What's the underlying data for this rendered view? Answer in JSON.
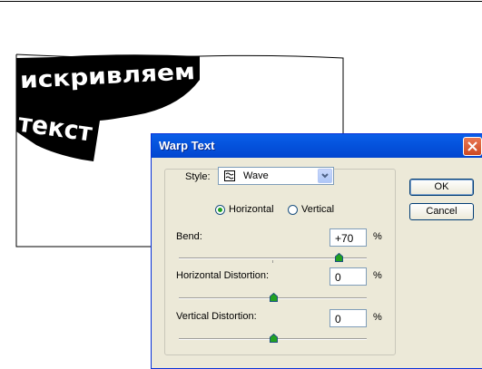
{
  "canvas": {
    "warped_line1": "искривляем",
    "warped_line2": "текст"
  },
  "dialog": {
    "title": "Warp Text",
    "style_label": "Style:",
    "style_value": "Wave",
    "style_icon": "wave-style-icon",
    "orientation_options": [
      "Horizontal",
      "Vertical"
    ],
    "orientation_selected": "Horizontal",
    "bend_label": "Bend:",
    "bend_value": "+70",
    "bend_unit": "%",
    "bend_slider_fraction": 0.85,
    "hdist_label": "Horizontal Distortion:",
    "hdist_value": "0",
    "hdist_unit": "%",
    "hdist_slider_fraction": 0.5,
    "vdist_label": "Vertical Distortion:",
    "vdist_value": "0",
    "vdist_unit": "%",
    "vdist_slider_fraction": 0.5,
    "ok_label": "OK",
    "cancel_label": "Cancel"
  },
  "colors": {
    "titlebar": "#0554de",
    "dialog_bg": "#ece9d8",
    "close_button": "#cd4a22",
    "radio_dot": "#21a121"
  }
}
